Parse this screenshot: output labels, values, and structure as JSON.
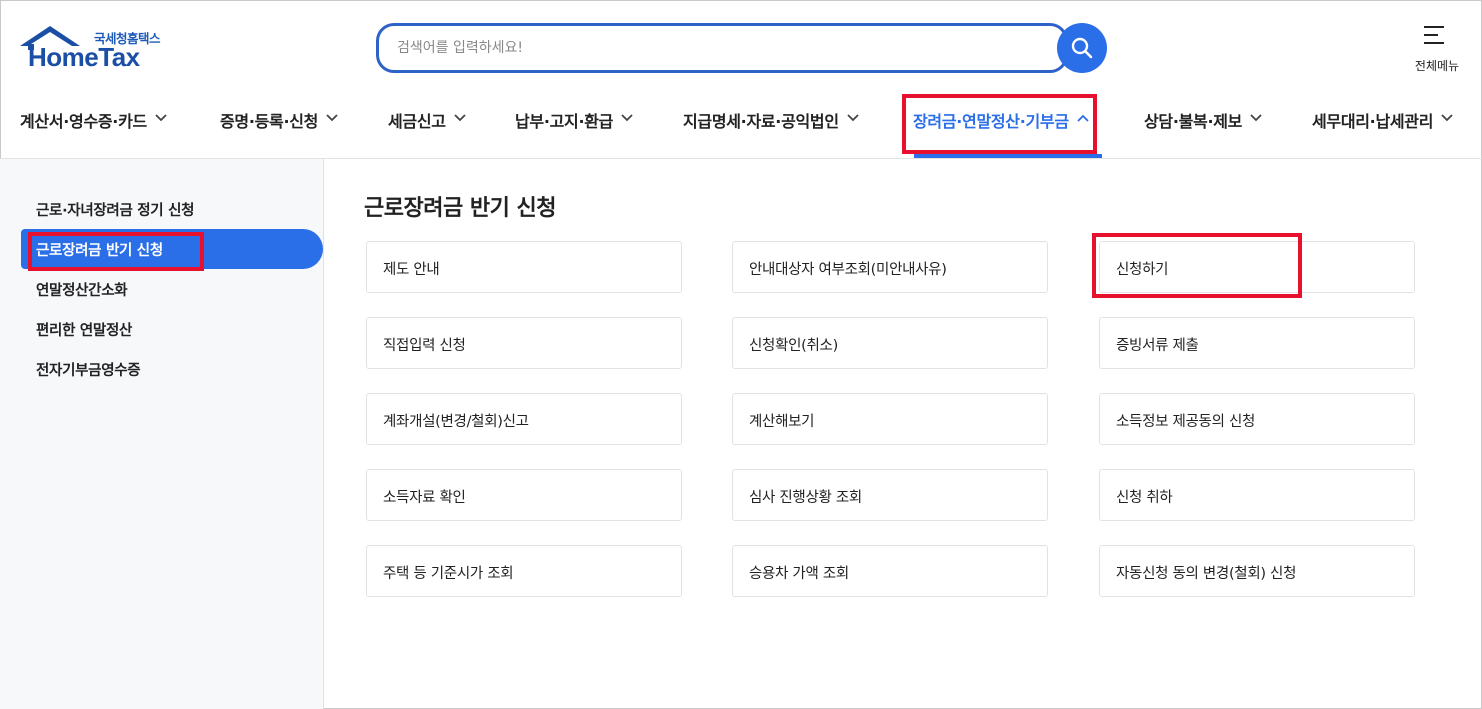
{
  "header": {
    "logo_sub": "국세청홈택스",
    "logo_main": "HomeTax",
    "search_placeholder": "검색어를 입력하세요!",
    "all_menu_label": "전체메뉴"
  },
  "nav": {
    "items": [
      {
        "label": "계산서·영수증·카드"
      },
      {
        "label": "증명·등록·신청"
      },
      {
        "label": "세금신고"
      },
      {
        "label": "납부·고지·환급"
      },
      {
        "label": "지급명세·자료·공익법인"
      },
      {
        "label": "장려금·연말정산·기부금",
        "active": true
      },
      {
        "label": "상담·불복·제보"
      },
      {
        "label": "세무대리·납세관리"
      }
    ]
  },
  "sidebar": {
    "items": [
      {
        "label": "근로·자녀장려금 정기 신청"
      },
      {
        "label": "근로장려금 반기 신청",
        "active": true
      },
      {
        "label": "연말정산간소화"
      },
      {
        "label": "편리한 연말정산"
      },
      {
        "label": "전자기부금영수증"
      }
    ]
  },
  "main": {
    "title": "근로장려금 반기 신청",
    "tiles": [
      {
        "label": "제도 안내"
      },
      {
        "label": "안내대상자 여부조회(미안내사유)"
      },
      {
        "label": "신청하기",
        "highlighted": true
      },
      {
        "label": "직접입력 신청"
      },
      {
        "label": "신청확인(취소)"
      },
      {
        "label": "증빙서류 제출"
      },
      {
        "label": "계좌개설(변경/철회)신고"
      },
      {
        "label": "계산해보기"
      },
      {
        "label": "소득정보 제공동의 신청"
      },
      {
        "label": "소득자료 확인"
      },
      {
        "label": "심사 진행상황 조회"
      },
      {
        "label": "신청 취하"
      },
      {
        "label": "주택 등 기준시가 조회"
      },
      {
        "label": "승용차 가액 조회"
      },
      {
        "label": "자동신청 동의 변경(철회) 신청"
      }
    ]
  },
  "colors": {
    "accent": "#2a6ee8",
    "highlight_box": "#e8112d",
    "logo_blue": "#1b4fa6"
  }
}
